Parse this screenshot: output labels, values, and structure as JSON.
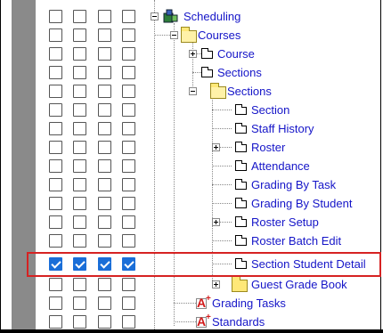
{
  "tree": {
    "items": [
      {
        "label": "Scheduling",
        "icon": "scheduling-icon",
        "checked": false
      },
      {
        "label": "Courses",
        "icon": "folder-open-icon",
        "checked": false
      },
      {
        "label": "Course",
        "icon": "page-icon",
        "checked": false
      },
      {
        "label": "Sections",
        "icon": "page-icon",
        "checked": false
      },
      {
        "label": "Sections",
        "icon": "folder-open-icon",
        "checked": false
      },
      {
        "label": "Section",
        "icon": "page-icon",
        "checked": false
      },
      {
        "label": "Staff History",
        "icon": "page-icon",
        "checked": false
      },
      {
        "label": "Roster",
        "icon": "page-icon",
        "checked": false
      },
      {
        "label": "Attendance",
        "icon": "page-icon",
        "checked": false
      },
      {
        "label": "Grading By Task",
        "icon": "page-icon",
        "checked": false
      },
      {
        "label": "Grading By Student",
        "icon": "page-icon",
        "checked": false
      },
      {
        "label": "Roster Setup",
        "icon": "page-icon",
        "checked": false
      },
      {
        "label": "Roster Batch Edit",
        "icon": "page-icon",
        "checked": false
      },
      {
        "label": "Section Student Detail",
        "icon": "page-icon",
        "checked": true
      },
      {
        "label": "Guest Grade Book",
        "icon": "folder-icon",
        "checked": false
      },
      {
        "label": "Grading Tasks",
        "icon": "report-icon",
        "checked": false
      },
      {
        "label": "Standards",
        "icon": "report-icon",
        "checked": false
      }
    ]
  },
  "colors": {
    "link": "#1515c8",
    "checked": "#1a6ed8",
    "highlight": "#d62222",
    "gutter": "#8a8a8a"
  }
}
